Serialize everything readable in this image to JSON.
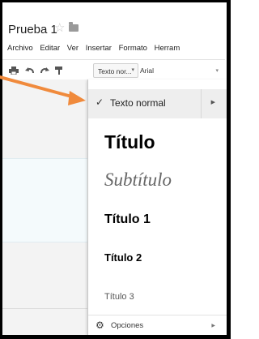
{
  "document": {
    "title": "Prueba 1",
    "star_icon": "star-icon",
    "folder_icon": "folder-icon"
  },
  "menubar": [
    "Archivo",
    "Editar",
    "Ver",
    "Insertar",
    "Formato",
    "Herram"
  ],
  "toolbar": {
    "icons": [
      "print-icon",
      "undo-icon",
      "redo-icon",
      "paint-format-icon"
    ],
    "style_select": "Texto nor...",
    "font_select": "Arial"
  },
  "style_menu": {
    "selected": "Texto normal",
    "items": {
      "title": "Título",
      "subtitle": "Subtítulo",
      "h1": "Título 1",
      "h2": "Título 2",
      "h3": "Título 3"
    },
    "options": "Opciones"
  },
  "annotation": {
    "arrow_color": "#f08a3c"
  }
}
